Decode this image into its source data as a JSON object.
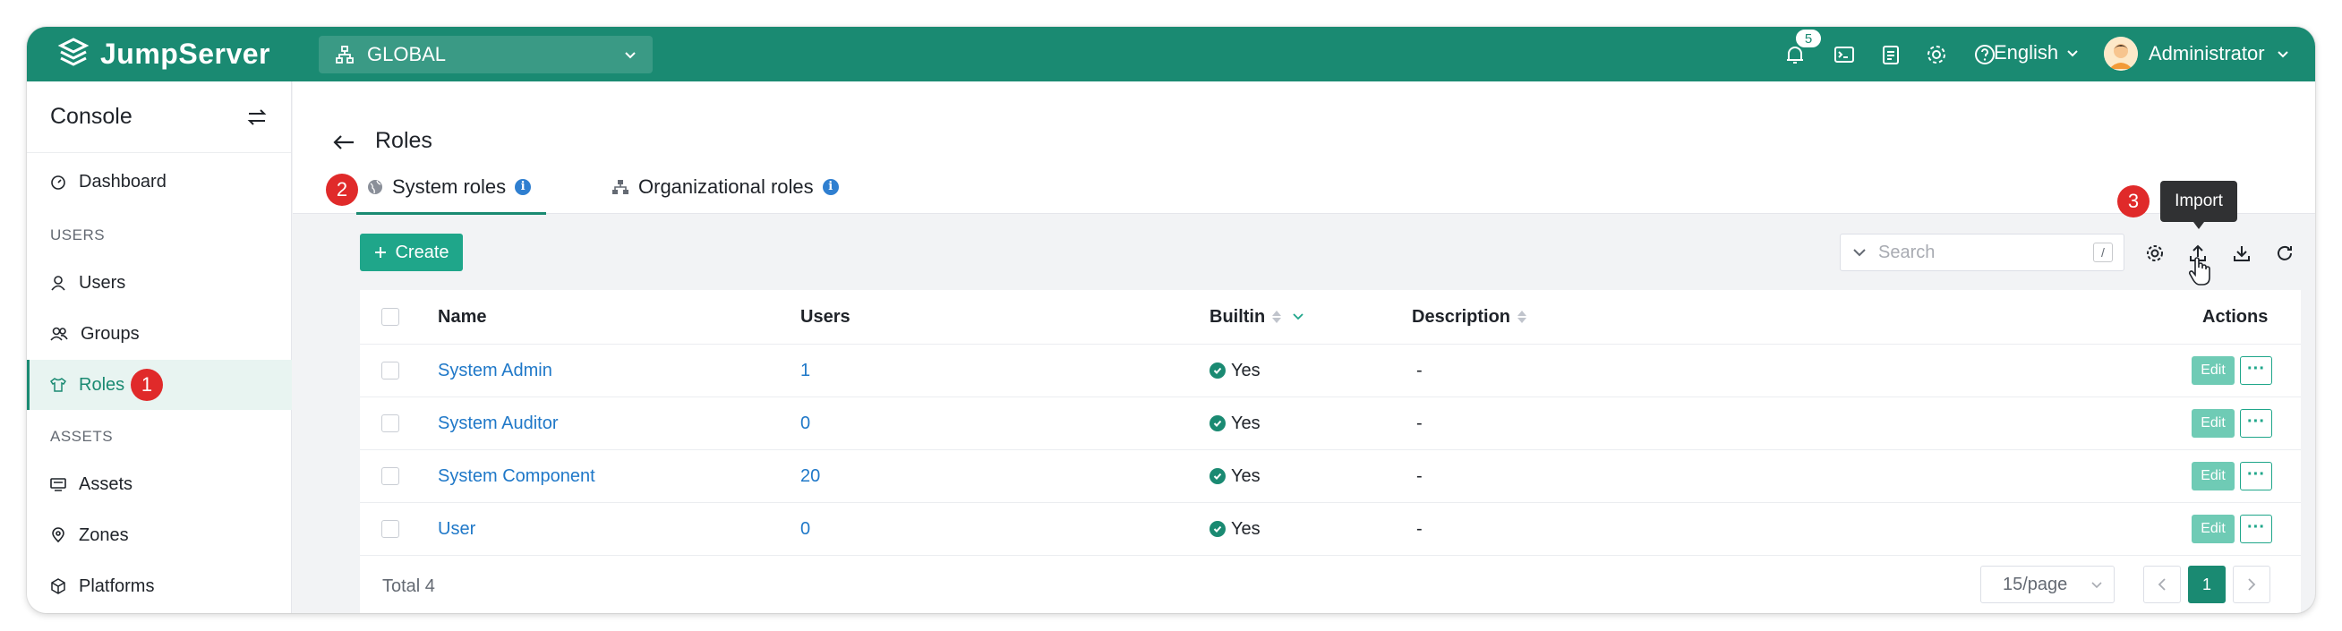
{
  "topbar": {
    "brand": "JumpServer",
    "org_select": "GLOBAL",
    "notification_count": "5",
    "language": "English",
    "user_name": "Administrator"
  },
  "sidebar": {
    "title": "Console",
    "items": [
      {
        "label": "Dashboard",
        "icon": "dashboard-icon"
      },
      {
        "section": "USERS"
      },
      {
        "label": "Users",
        "icon": "user-icon"
      },
      {
        "label": "Groups",
        "icon": "groups-icon"
      },
      {
        "label": "Roles",
        "icon": "shirt-icon",
        "active": true
      },
      {
        "section": "ASSETS"
      },
      {
        "label": "Assets",
        "icon": "monitor-icon"
      },
      {
        "label": "Zones",
        "icon": "location-icon"
      },
      {
        "label": "Platforms",
        "icon": "cube-icon"
      }
    ]
  },
  "steps": [
    "1",
    "2",
    "3"
  ],
  "page": {
    "title": "Roles",
    "tabs": [
      {
        "label": "System roles",
        "active": true
      },
      {
        "label": "Organizational roles"
      }
    ]
  },
  "toolbar": {
    "create_label": "Create",
    "search_placeholder": "Search",
    "search_shortcut": "/",
    "tooltip": "Import"
  },
  "table": {
    "headers": {
      "name": "Name",
      "users": "Users",
      "builtin": "Builtin",
      "description": "Description",
      "actions": "Actions"
    },
    "rows": [
      {
        "name": "System Admin",
        "users": "1",
        "builtin": "Yes",
        "description": "-"
      },
      {
        "name": "System Auditor",
        "users": "0",
        "builtin": "Yes",
        "description": "-"
      },
      {
        "name": "System Component",
        "users": "20",
        "builtin": "Yes",
        "description": "-"
      },
      {
        "name": "User",
        "users": "0",
        "builtin": "Yes",
        "description": "-"
      }
    ],
    "edit_label": "Edit",
    "more_label": "···"
  },
  "pagination": {
    "total": "Total 4",
    "page_size": "15/page",
    "current_page": "1"
  },
  "colors": {
    "brand": "#1a8a72",
    "link": "#1f78c8",
    "step_badge": "#e02a2a"
  }
}
